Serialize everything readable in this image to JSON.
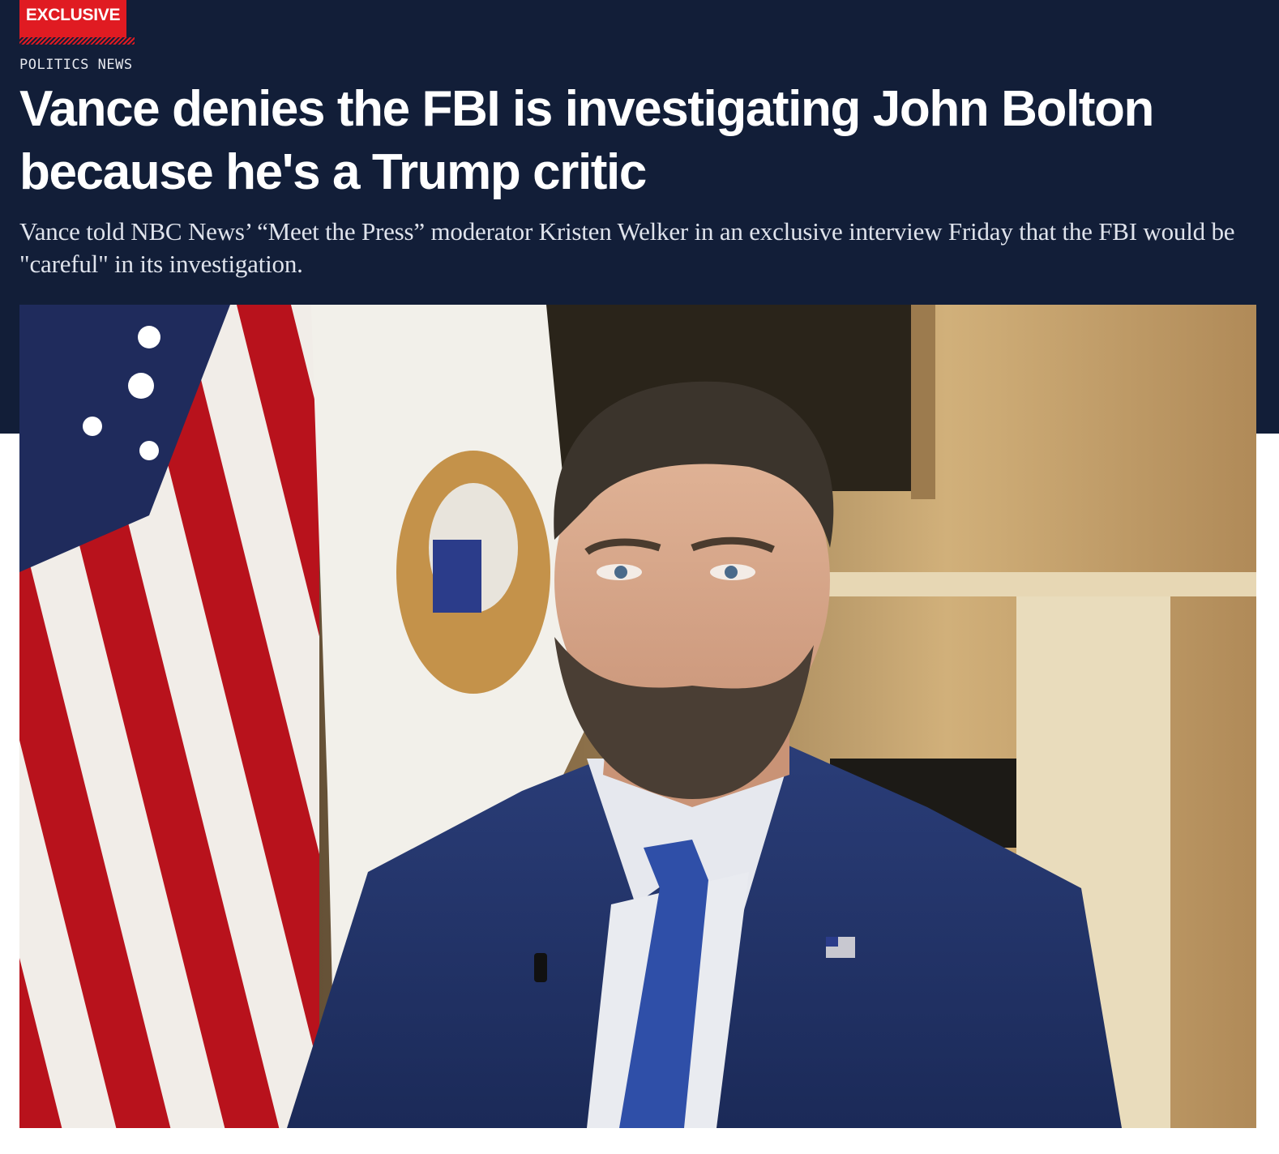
{
  "article": {
    "badge": "EXCLUSIVE",
    "section": "POLITICS NEWS",
    "headline": "Vance denies the FBI is investigating John Bolton because he's a Trump critic",
    "dek": "Vance told NBC News’ “Meet the Press” moderator Kristen Welker in an exclusive interview Friday that the FBI would be \"careful\" in its investigation."
  },
  "colors": {
    "header_background": "#121e38",
    "badge_red": "#e01b22"
  }
}
